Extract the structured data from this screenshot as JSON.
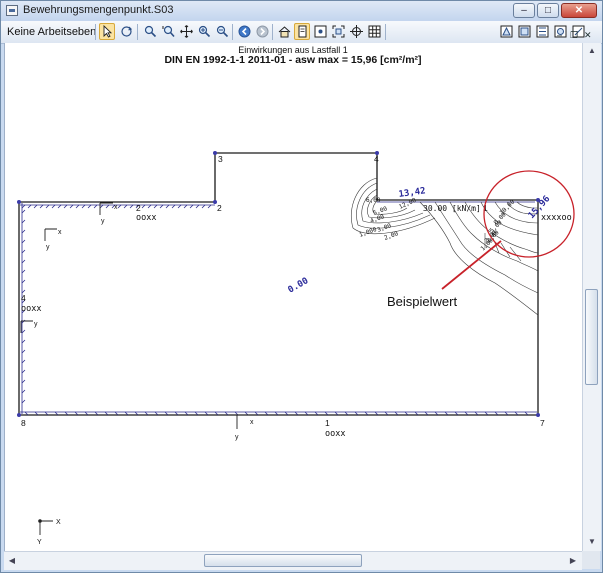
{
  "window": {
    "title": "Bewehrungsmengenpunkt.S03",
    "controls": {
      "minimize": "–",
      "maximize": "□",
      "close": "✕"
    },
    "mdi_controls": {
      "minimize": "–",
      "restore": "❐",
      "close": "✕"
    }
  },
  "toolbar": {
    "layer_dropdown": "Keine Arbeitseben",
    "icons": [
      "select-arrow-icon",
      "rotate-view-icon",
      "zoom-icon",
      "zoom-window-icon",
      "pan-icon",
      "zoom-in-icon",
      "zoom-out-icon",
      "back-icon",
      "forward-icon",
      "home-icon",
      "page-icon",
      "node-icon",
      "fit-icon",
      "grid-icon",
      "view-1-icon",
      "view-2-icon",
      "view-3-icon",
      "view-4-icon",
      "view-5-icon"
    ]
  },
  "drawing": {
    "header_line1": "Einwirkungen aus Lastfall 1",
    "header_line2": "DIN EN 1992-1-1 2011-01 - asw max = 15,96 [cm²/m²]",
    "node_labels": [
      "3",
      "4",
      "2",
      "2",
      "1",
      "4",
      "8",
      "1",
      "7"
    ],
    "element_labels": [
      "ooxx",
      "ooxx",
      "ooxx",
      "xxxxoo"
    ],
    "axis_labels": {
      "x": "x",
      "y": "y",
      "X": "X",
      "Y": "Y"
    },
    "values": {
      "center": "0.00",
      "max_top": "13,42",
      "load": "30.00 [kN/m]",
      "max_corner": "15,96",
      "contour_labels": [
        "6,00",
        "5,00",
        "4,00",
        "3,00",
        "2,00",
        "1,000",
        "12,00",
        "10,00",
        "8,00",
        "5,00",
        "3,00",
        "1,00",
        "2,00"
      ]
    },
    "annotation": "Beispielwert",
    "colors": {
      "structure": "#1a1a1a",
      "support_hatch": "#2b2b8c",
      "value_text": "#2a2a9a",
      "callout_circle": "#c8222a",
      "node": "#3b3ba8"
    }
  },
  "scrollbars": {
    "up": "▲",
    "down": "▼",
    "left": "◀",
    "right": "▶"
  }
}
